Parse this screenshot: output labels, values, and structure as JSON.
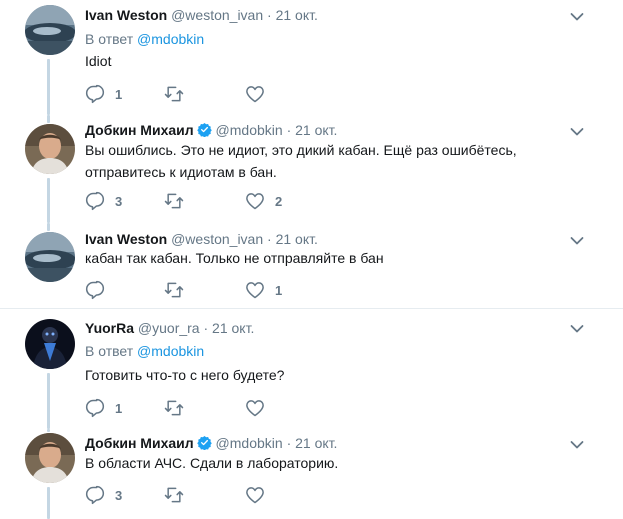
{
  "tweets": [
    {
      "author": "Ivan Weston",
      "handle": "@weston_ivan",
      "time": "21 окт.",
      "reply_prefix": "В ответ",
      "reply_handle": "@mdobkin",
      "text": "Idiot",
      "replies": "1",
      "retweets": "",
      "likes": ""
    },
    {
      "author": "Добкин Михаил",
      "handle": "@mdobkin",
      "time": "21 окт.",
      "verified": true,
      "text_line1": "Вы ошиблись. Это не идиот, это дикий кабан. Ещё раз ошибётесь,",
      "text_line2": "отправитесь к идиотам в бан.",
      "replies": "3",
      "retweets": "",
      "likes": "2"
    },
    {
      "author": "Ivan Weston",
      "handle": "@weston_ivan",
      "time": "21 окт.",
      "text": "кабан так кабан. Только не отправляйте в бан",
      "replies": "",
      "retweets": "",
      "likes": "1"
    },
    {
      "author": "YuorRa",
      "handle": "@yuor_ra",
      "time": "21 окт.",
      "reply_prefix": "В ответ",
      "reply_handle": "@mdobkin",
      "text": "Готовить что-то с него будете?",
      "replies": "1",
      "retweets": "",
      "likes": ""
    },
    {
      "author": "Добкин Михаил",
      "handle": "@mdobkin",
      "time": "21 окт.",
      "verified": true,
      "text": "В области АЧС. Сдали в лабораторию.",
      "replies": "3",
      "retweets": "",
      "likes": ""
    }
  ],
  "separator": "·",
  "colors": {
    "link": "#1b95e0",
    "muted": "#657786",
    "thread_line": "#c4d6e3",
    "divider": "#e6ecf0"
  },
  "icons": [
    "reply-icon",
    "retweet-icon",
    "like-icon",
    "chevron-down-icon",
    "verified-badge-icon"
  ]
}
